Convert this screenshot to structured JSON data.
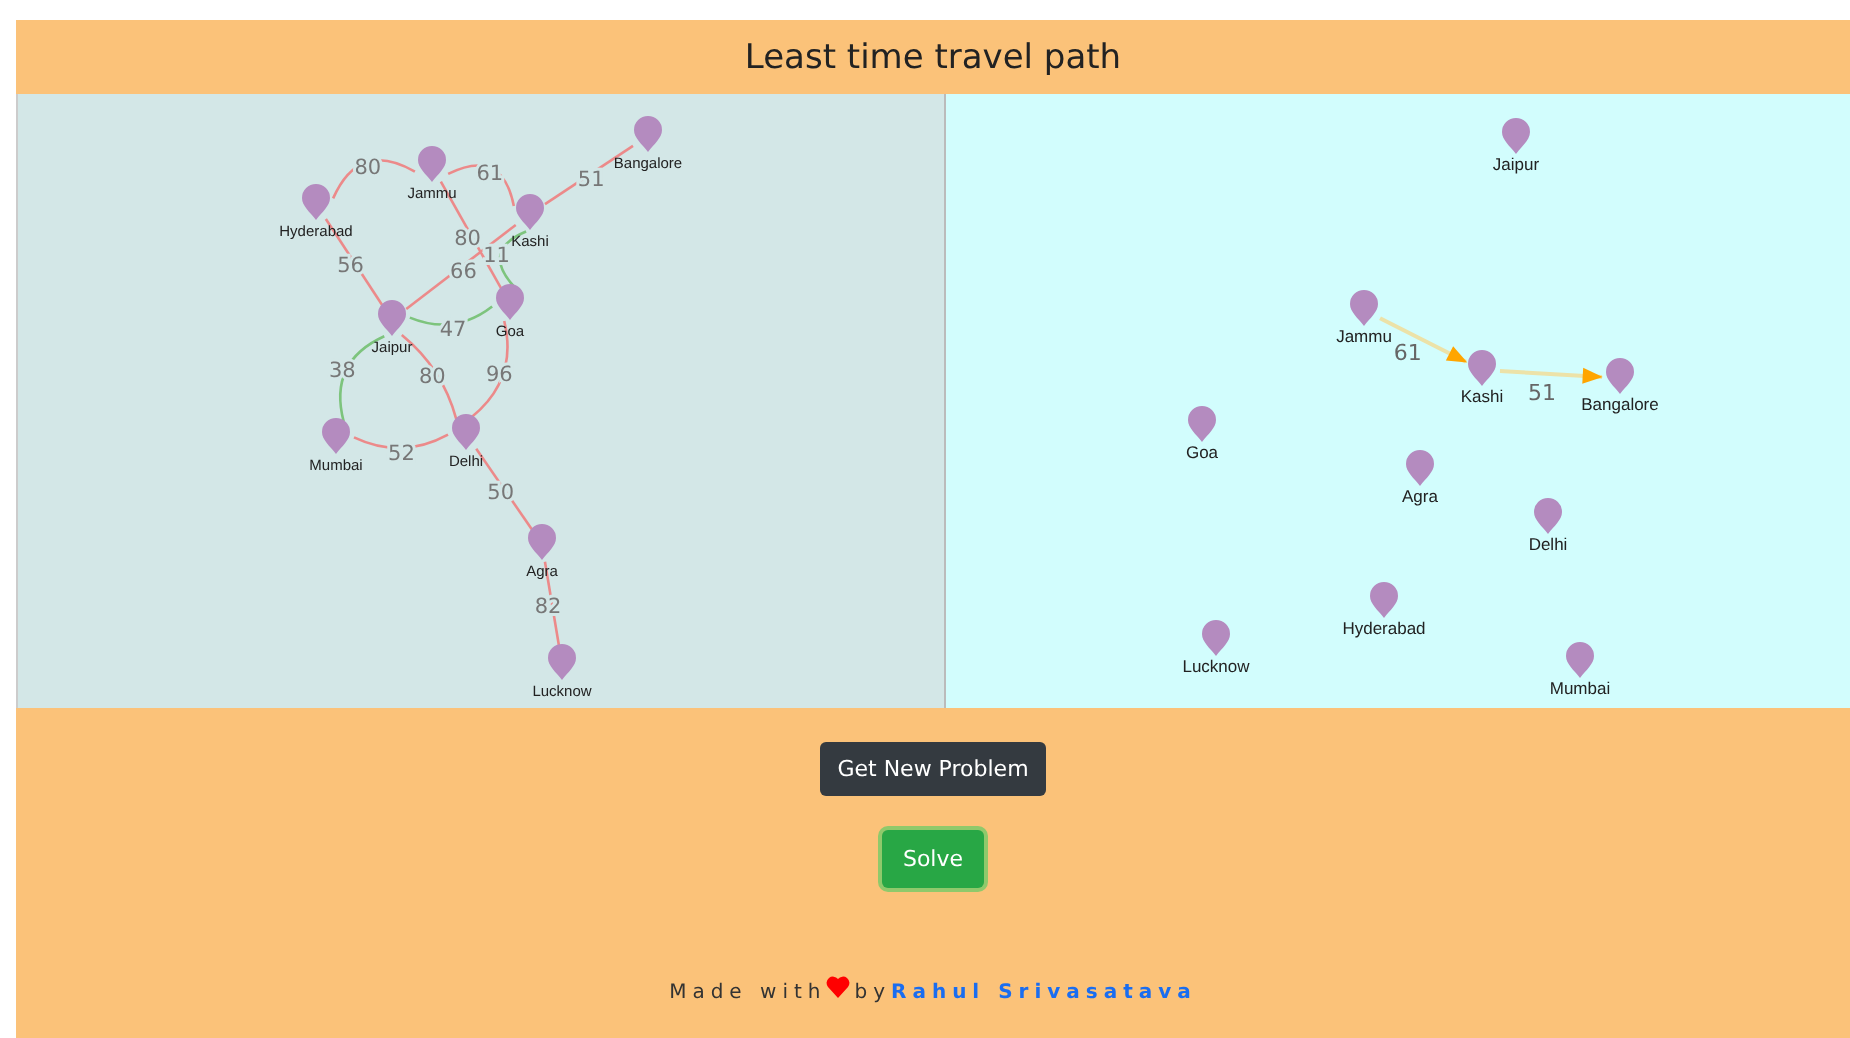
{
  "header": {
    "title": "Least time travel path"
  },
  "problem_graph": {
    "nodes": [
      "Bangalore",
      "Jammu",
      "Hyderabad",
      "Kashi",
      "Goa",
      "Jaipur",
      "Mumbai",
      "Delhi",
      "Agra",
      "Lucknow"
    ],
    "edges": [
      {
        "weight": "80",
        "on_path": false
      },
      {
        "weight": "61",
        "on_path": false
      },
      {
        "weight": "51",
        "on_path": false
      },
      {
        "weight": "80",
        "on_path": false
      },
      {
        "weight": "56",
        "on_path": false
      },
      {
        "weight": "66",
        "on_path": false
      },
      {
        "weight": "11",
        "on_path": true
      },
      {
        "weight": "47",
        "on_path": true
      },
      {
        "weight": "38",
        "on_path": true
      },
      {
        "weight": "80",
        "on_path": false
      },
      {
        "weight": "96",
        "on_path": false
      },
      {
        "weight": "52",
        "on_path": false
      },
      {
        "weight": "50",
        "on_path": false
      },
      {
        "weight": "82",
        "on_path": false
      }
    ]
  },
  "solution_graph": {
    "nodes": [
      "Jaipur",
      "Jammu",
      "Kashi",
      "Bangalore",
      "Goa",
      "Agra",
      "Delhi",
      "Hyderabad",
      "Lucknow",
      "Mumbai"
    ],
    "edges": [
      {
        "weight": "61"
      },
      {
        "weight": "51"
      }
    ]
  },
  "buttons": [
    {
      "label": "Get New Problem",
      "kind": "dark"
    },
    {
      "label": "Solve",
      "kind": "success"
    }
  ],
  "footer": {
    "made_with": "Made with",
    "by": "by",
    "author": "Rahul Srivasatava"
  }
}
